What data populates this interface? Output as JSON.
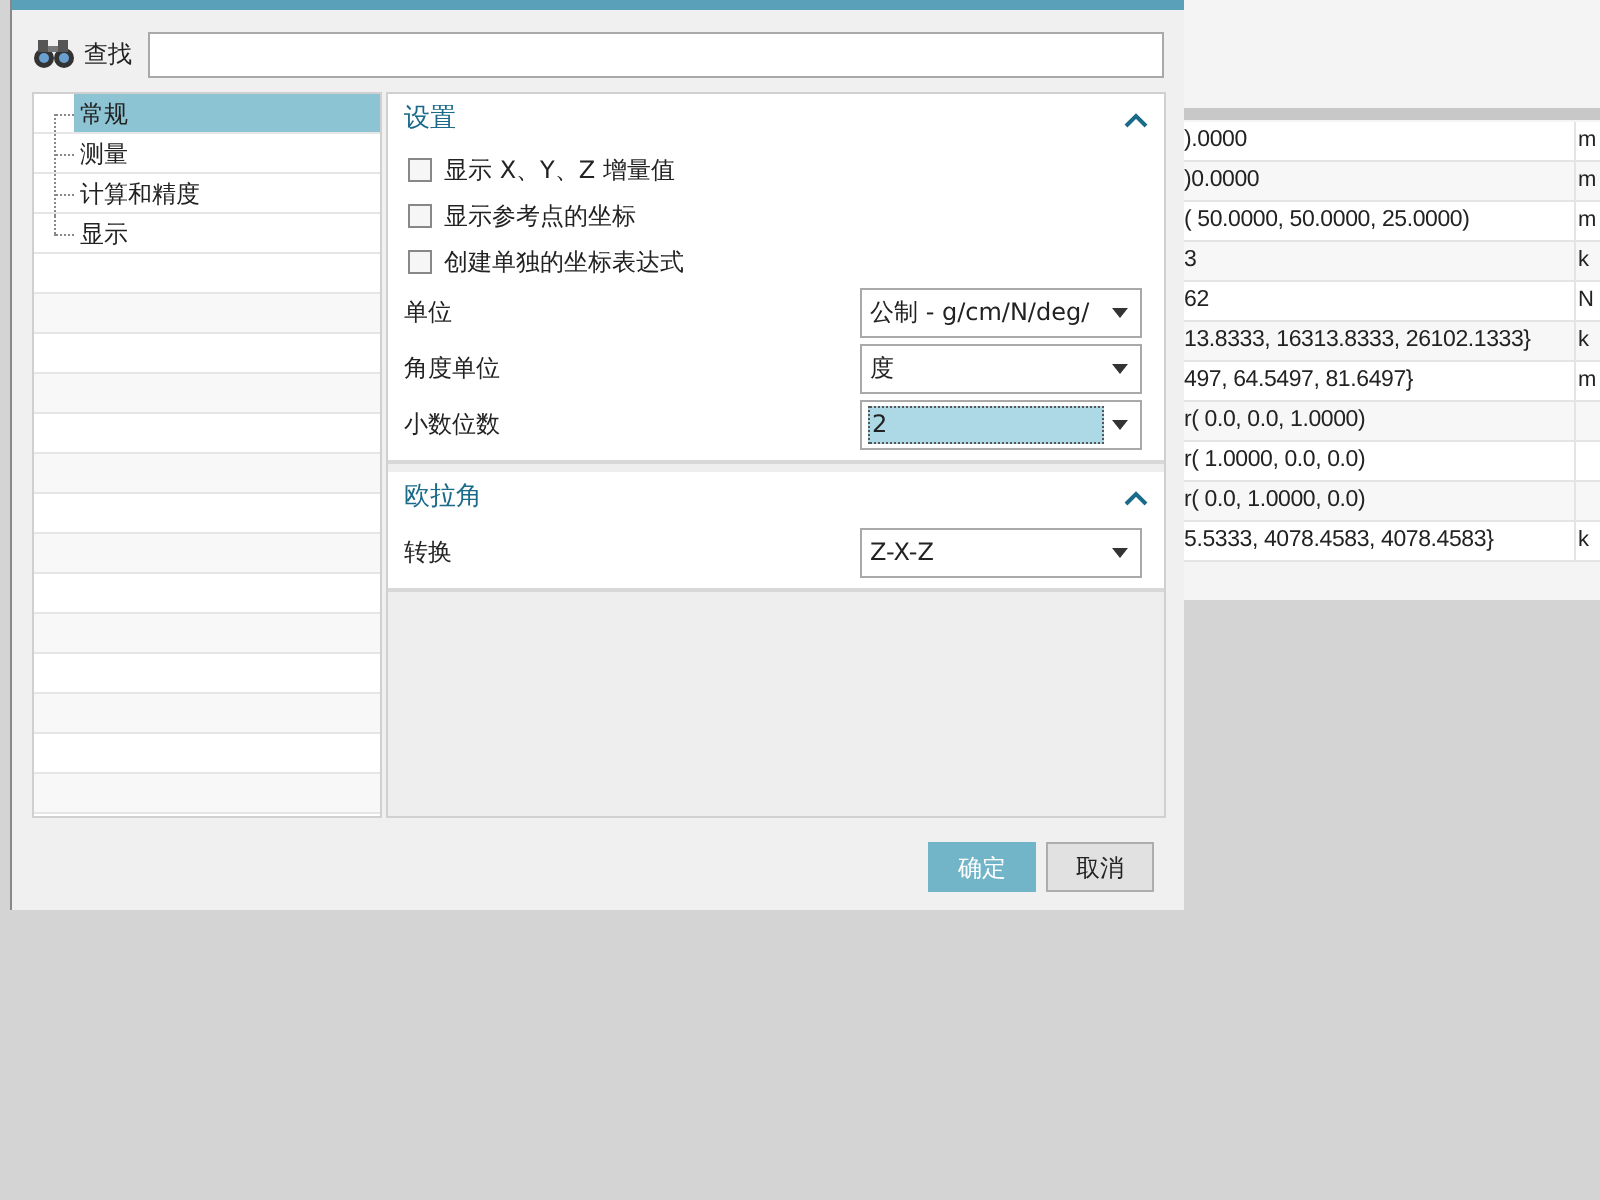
{
  "search": {
    "label": "查找"
  },
  "tree": [
    {
      "label": "常规",
      "selected": true
    },
    {
      "label": "测量",
      "selected": false
    },
    {
      "label": "计算和精度",
      "selected": false
    },
    {
      "label": "显示",
      "selected": false
    }
  ],
  "sections": [
    {
      "title": "设置",
      "expanded": true,
      "rows": [
        {
          "kind": "checkbox",
          "label": "显示 X、Y、Z 增量值",
          "checked": false
        },
        {
          "kind": "checkbox",
          "label": "显示参考点的坐标",
          "checked": false
        },
        {
          "kind": "checkbox",
          "label": "创建单独的坐标表达式",
          "checked": false
        },
        {
          "kind": "select",
          "label": "单位",
          "value": "公制 - g/cm/N/deg/",
          "focused": false
        },
        {
          "kind": "select",
          "label": "角度单位",
          "value": "度",
          "focused": false
        },
        {
          "kind": "select",
          "label": "小数位数",
          "value": "2",
          "focused": true
        }
      ]
    },
    {
      "title": "欧拉角",
      "expanded": true,
      "rows": [
        {
          "kind": "select",
          "label": "转换",
          "value": "Z-X-Z",
          "focused": false
        }
      ]
    }
  ],
  "buttons": [
    {
      "label": "确定",
      "primary": true
    },
    {
      "label": "取消",
      "primary": false
    }
  ],
  "background_table": {
    "rows": [
      {
        "value": ").0000",
        "unit": "m"
      },
      {
        "value": ")0.0000",
        "unit": "m"
      },
      {
        "value": "( 50.0000, 50.0000, 25.0000)",
        "unit": "m"
      },
      {
        "value": "3",
        "unit": "k"
      },
      {
        "value": "62",
        "unit": "N"
      },
      {
        "value": "13.8333, 16313.8333, 26102.1333}",
        "unit": "k"
      },
      {
        "value": "497, 64.5497, 81.6497}",
        "unit": "m"
      },
      {
        "value": "r( 0.0, 0.0, 1.0000)"
      },
      {
        "value": "r( 1.0000, 0.0, 0.0)"
      },
      {
        "value": "r( 0.0, 1.0000, 0.0)"
      },
      {
        "value": "5.5333, 4078.4583, 4078.4583}",
        "unit": "k"
      }
    ]
  }
}
